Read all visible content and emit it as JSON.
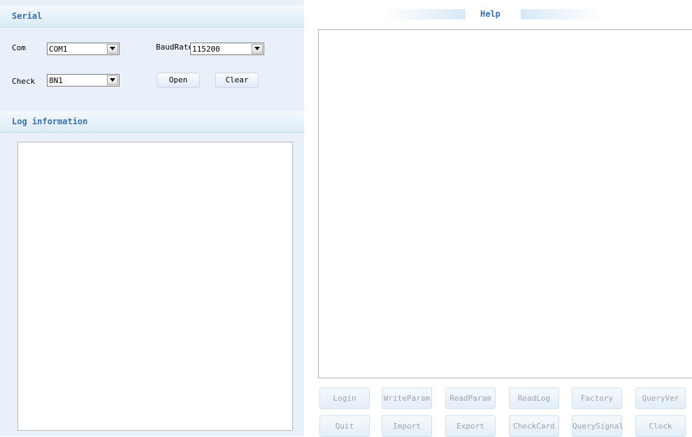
{
  "serial": {
    "title": "Serial",
    "com_label": "Com",
    "com_value": "COM1",
    "baudrate_label": "BaudRate",
    "baudrate_value": "115200",
    "check_label": "Check",
    "check_value": "8N1",
    "open_label": "Open",
    "clear_label": "Clear"
  },
  "log": {
    "title": "Log information",
    "text": ""
  },
  "help": {
    "title": "Help",
    "text": ""
  },
  "actions": {
    "row1": [
      "Login",
      "WriteParam",
      "ReadParam",
      "ReadLog",
      "Factory",
      "QueryVer"
    ],
    "row2": [
      "Quit",
      "Import",
      "Export",
      "CheckCard",
      "QuerySignal",
      "Clock"
    ]
  },
  "icons": {
    "dropdown": "chevron-down-icon"
  },
  "colors": {
    "header_text": "#3a6fa8",
    "panel_bg": "#e8f1f9",
    "disabled_text": "#9aa4ad"
  }
}
